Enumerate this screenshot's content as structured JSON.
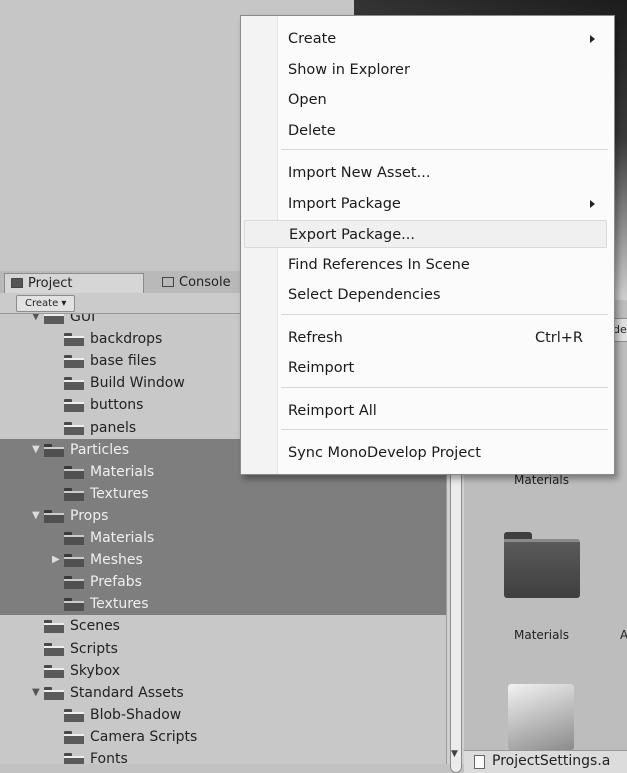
{
  "tabs": {
    "project": "Project",
    "console": "Console"
  },
  "toolbar": {
    "create_label": "Create ▾"
  },
  "tree": [
    {
      "label": "GUI",
      "depth": 0,
      "expanded": true,
      "selected": false
    },
    {
      "label": "backdrops",
      "depth": 1,
      "expanded": false,
      "selected": false
    },
    {
      "label": "base files",
      "depth": 1,
      "expanded": false,
      "selected": false
    },
    {
      "label": "Build Window",
      "depth": 1,
      "expanded": false,
      "selected": false
    },
    {
      "label": "buttons",
      "depth": 1,
      "expanded": false,
      "selected": false
    },
    {
      "label": "panels",
      "depth": 1,
      "expanded": false,
      "selected": false
    },
    {
      "label": "Particles",
      "depth": 0,
      "expanded": true,
      "selected": true
    },
    {
      "label": "Materials",
      "depth": 1,
      "expanded": false,
      "selected": true
    },
    {
      "label": "Textures",
      "depth": 1,
      "expanded": false,
      "selected": true
    },
    {
      "label": "Props",
      "depth": 0,
      "expanded": true,
      "selected": true
    },
    {
      "label": "Materials",
      "depth": 1,
      "expanded": false,
      "selected": true
    },
    {
      "label": "Meshes",
      "depth": 1,
      "expanded": false,
      "collapsed_arrow": true,
      "selected": true
    },
    {
      "label": "Prefabs",
      "depth": 1,
      "expanded": false,
      "selected": true
    },
    {
      "label": "Textures",
      "depth": 1,
      "expanded": false,
      "selected": true
    },
    {
      "label": "Scenes",
      "depth": 0,
      "expanded": false,
      "selected": false
    },
    {
      "label": "Scripts",
      "depth": 0,
      "expanded": false,
      "selected": false
    },
    {
      "label": "Skybox",
      "depth": 0,
      "expanded": false,
      "selected": false
    },
    {
      "label": "Standard Assets",
      "depth": 0,
      "expanded": true,
      "selected": false
    },
    {
      "label": "Blob-Shadow",
      "depth": 1,
      "expanded": false,
      "selected": false
    },
    {
      "label": "Camera Scripts",
      "depth": 1,
      "expanded": false,
      "selected": false
    },
    {
      "label": "Fonts",
      "depth": 1,
      "expanded": false,
      "selected": false
    }
  ],
  "grid": {
    "top_chip": "de",
    "label_1": "Materials",
    "label_2": "Materials",
    "label_2b": "A",
    "file_label": "ProjectSettings.a"
  },
  "context_menu": {
    "items": [
      {
        "label": "Create",
        "shortcut": "",
        "submenu": true
      },
      {
        "label": "Show in Explorer",
        "shortcut": "",
        "submenu": false
      },
      {
        "label": "Open",
        "shortcut": "",
        "submenu": false
      },
      {
        "label": "Delete",
        "shortcut": "",
        "submenu": false
      },
      {
        "separator": true
      },
      {
        "label": "Import New Asset...",
        "shortcut": "",
        "submenu": false
      },
      {
        "label": "Import Package",
        "shortcut": "",
        "submenu": true
      },
      {
        "label": "Export Package...",
        "shortcut": "",
        "submenu": false,
        "highlighted": true
      },
      {
        "label": "Find References In Scene",
        "shortcut": "",
        "submenu": false
      },
      {
        "label": "Select Dependencies",
        "shortcut": "",
        "submenu": false
      },
      {
        "separator": true
      },
      {
        "label": "Refresh",
        "shortcut": "Ctrl+R",
        "submenu": false
      },
      {
        "label": "Reimport",
        "shortcut": "",
        "submenu": false
      },
      {
        "separator": true
      },
      {
        "label": "Reimport All",
        "shortcut": "",
        "submenu": false
      },
      {
        "separator": true
      },
      {
        "label": "Sync MonoDevelop Project",
        "shortcut": "",
        "submenu": false
      }
    ]
  },
  "icons": {
    "folder": "folder-icon",
    "submenu": "chevron-right-icon",
    "expand": "triangle-down-icon",
    "collapse": "triangle-right-icon",
    "file": "file-icon"
  }
}
